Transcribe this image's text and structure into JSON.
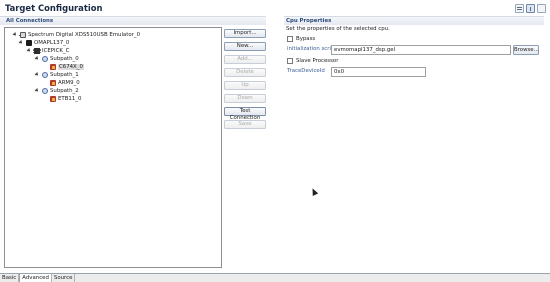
{
  "page": {
    "title": "Target Configuration"
  },
  "left": {
    "header": "All Connections",
    "tree": [
      {
        "label": "Spectrum Digital XDS510USB Emulator_0",
        "icon": "emulator-icon"
      },
      {
        "label": "OMAPL137_0",
        "icon": "board-icon"
      },
      {
        "label": "ICEPICK_C",
        "icon": "chip-icon"
      },
      {
        "label": "Subpath_0",
        "icon": "subpath-icon"
      },
      {
        "label": "C674X_0",
        "icon": "cpu-icon"
      },
      {
        "label": "Subpath_1",
        "icon": "subpath-icon"
      },
      {
        "label": "ARM9_0",
        "icon": "cpu-icon"
      },
      {
        "label": "Subpath_2",
        "icon": "subpath-icon"
      },
      {
        "label": "ETB11_0",
        "icon": "cpu-icon"
      }
    ],
    "buttons": {
      "import": "Import...",
      "new": "New...",
      "add": "Add...",
      "delete": "Delete",
      "up": "Up",
      "down": "Down",
      "test_connection": "Test Connection",
      "save": "Save"
    }
  },
  "right": {
    "header": "Cpu Properties",
    "description": "Set the properties of the selected cpu.",
    "bypass_label": "Bypass",
    "init_script_label": "initialization script",
    "init_script_value": "evmomapl137_dsp.gel",
    "browse_label": "Browse...",
    "slave_label": "Slave Processor",
    "trace_label": "TraceDeviceId",
    "trace_value": "0x0"
  },
  "tabs": [
    "Basic",
    "Advanced",
    "Source"
  ]
}
